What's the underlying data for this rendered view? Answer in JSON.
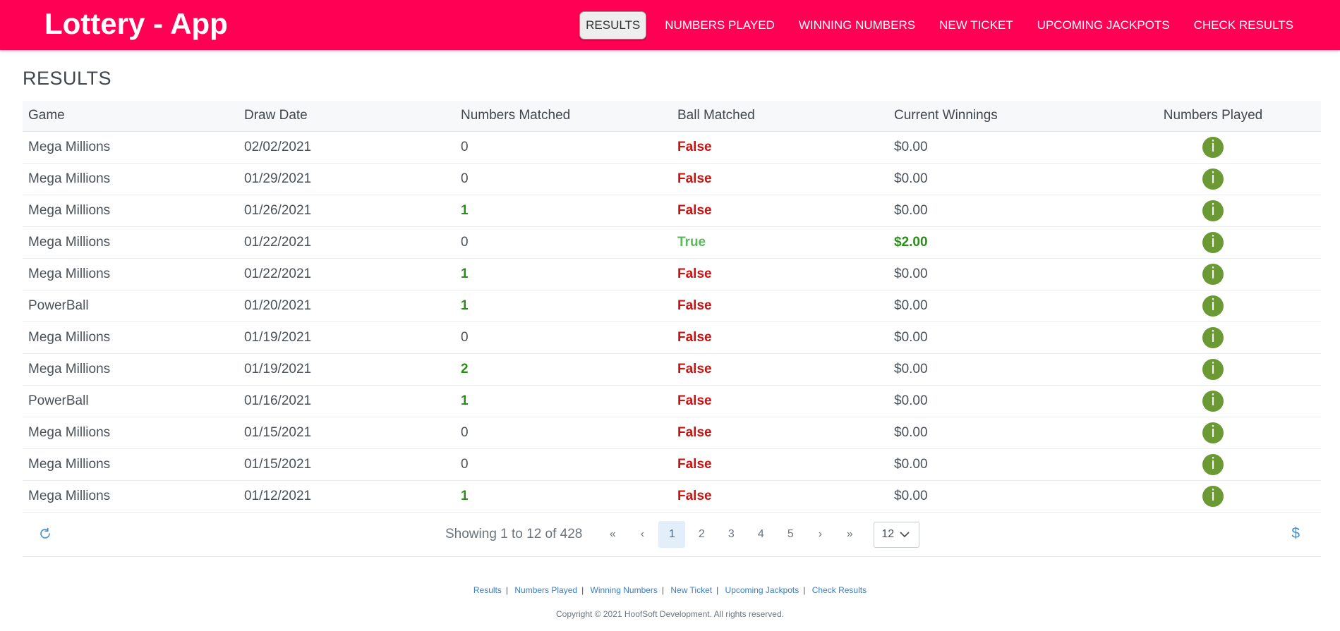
{
  "brand": "Lottery - App",
  "nav": [
    "RESULTS",
    "NUMBERS PLAYED",
    "WINNING NUMBERS",
    "NEW TICKET",
    "UPCOMING JACKPOTS",
    "CHECK RESULTS"
  ],
  "active_nav": "RESULTS",
  "page_title": "RESULTS",
  "table": {
    "columns": [
      "Game",
      "Draw Date",
      "Numbers Matched",
      "Ball Matched",
      "Current Winnings",
      "Numbers Played"
    ],
    "rows": [
      {
        "game": "Mega Millions",
        "date": "02/02/2021",
        "matched": "0",
        "ball": "False",
        "winnings": "$0.00"
      },
      {
        "game": "Mega Millions",
        "date": "01/29/2021",
        "matched": "0",
        "ball": "False",
        "winnings": "$0.00"
      },
      {
        "game": "Mega Millions",
        "date": "01/26/2021",
        "matched": "1",
        "ball": "False",
        "winnings": "$0.00"
      },
      {
        "game": "Mega Millions",
        "date": "01/22/2021",
        "matched": "0",
        "ball": "True",
        "winnings": "$2.00"
      },
      {
        "game": "Mega Millions",
        "date": "01/22/2021",
        "matched": "1",
        "ball": "False",
        "winnings": "$0.00"
      },
      {
        "game": "PowerBall",
        "date": "01/20/2021",
        "matched": "1",
        "ball": "False",
        "winnings": "$0.00"
      },
      {
        "game": "Mega Millions",
        "date": "01/19/2021",
        "matched": "0",
        "ball": "False",
        "winnings": "$0.00"
      },
      {
        "game": "Mega Millions",
        "date": "01/19/2021",
        "matched": "2",
        "ball": "False",
        "winnings": "$0.00"
      },
      {
        "game": "PowerBall",
        "date": "01/16/2021",
        "matched": "1",
        "ball": "False",
        "winnings": "$0.00"
      },
      {
        "game": "Mega Millions",
        "date": "01/15/2021",
        "matched": "0",
        "ball": "False",
        "winnings": "$0.00"
      },
      {
        "game": "Mega Millions",
        "date": "01/15/2021",
        "matched": "0",
        "ball": "False",
        "winnings": "$0.00"
      },
      {
        "game": "Mega Millions",
        "date": "01/12/2021",
        "matched": "1",
        "ball": "False",
        "winnings": "$0.00"
      }
    ]
  },
  "info_icon_glyph": "i",
  "pagination": {
    "showing": "Showing 1 to 12 of 428",
    "first": "«",
    "prev": "‹",
    "pages": [
      "1",
      "2",
      "3",
      "4",
      "5"
    ],
    "current": "1",
    "next": "›",
    "last": "»",
    "page_size": "12"
  },
  "icons": {
    "refresh": "refresh-icon",
    "dollar": "dollar-icon",
    "info": "info-icon"
  },
  "footer_links": [
    "Results",
    "Numbers Played",
    "Winning Numbers",
    "New Ticket",
    "Upcoming Jackpots",
    "Check Results"
  ],
  "copyright": "Copyright © 2021 HoofSoft Development. All rights reserved.",
  "colors": {
    "navbar": "#ff0055",
    "win_green": "#2e8b1e",
    "false_red": "#cc1111",
    "true_green": "#5cb85c",
    "info_green": "#6b9933",
    "link_blue": "#3a7ec2"
  }
}
